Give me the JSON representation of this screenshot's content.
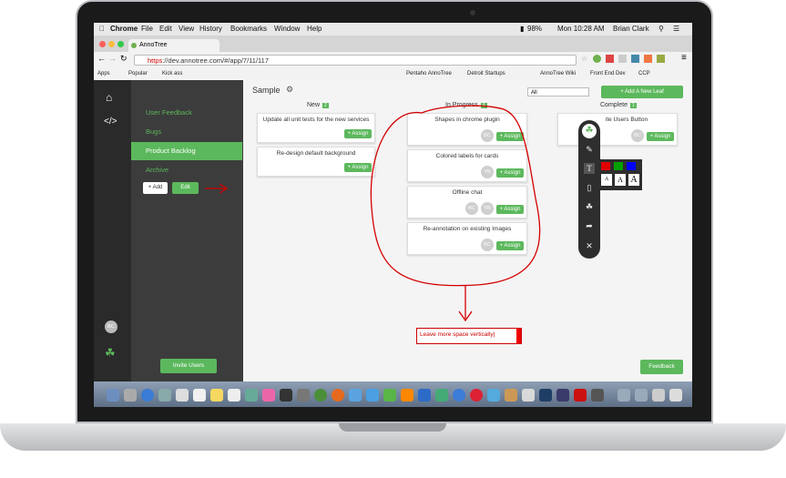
{
  "menubar": {
    "app_name": "Chrome",
    "items": [
      "File",
      "Edit",
      "View",
      "History",
      "Bookmarks",
      "Window",
      "Help"
    ],
    "battery": "98%",
    "clock": "Mon 10:28 AM",
    "user": "Brian Clark"
  },
  "browser": {
    "tab_title": "AnnoTree",
    "url_scheme": "https",
    "url_rest": "://dev.annotree.com/#/app/7/11/117",
    "bookmarks": [
      "Apps",
      "Popular",
      "Kick ass",
      "Pentaho AnnoTree",
      "Detroit Startups",
      "AnnoTree Wiki",
      "Front End Dev",
      "CCP"
    ]
  },
  "sidebar": {
    "items": [
      {
        "label": "User Feedback"
      },
      {
        "label": "Bugs"
      },
      {
        "label": "Product Backlog"
      },
      {
        "label": "Archive"
      }
    ],
    "add_label": "+ Add",
    "edit_label": "Edit",
    "invite_label": "Invite Users",
    "avatar": "BC"
  },
  "board": {
    "title": "Sample",
    "filter_value": "All",
    "add_leaf_label": "+ Add A New Leaf",
    "feedback_label": "Feedback",
    "columns": [
      {
        "title": "New",
        "count": "2",
        "cards": [
          {
            "title": "Update all unit tests for the new services",
            "assign": "+ Assign"
          },
          {
            "title": "Re-design default background",
            "assign": "+ Assign"
          }
        ]
      },
      {
        "title": "In Progress",
        "count": "4",
        "cards": [
          {
            "title": "Shapes in chrome plugin",
            "assign": "+ Assign",
            "avatars": [
              "BC"
            ]
          },
          {
            "title": "Colored labels for cards",
            "assign": "+ Assign",
            "avatars": [
              "YB"
            ]
          },
          {
            "title": "Offline chat",
            "assign": "+ Assign",
            "avatars": [
              "BC",
              "YB"
            ]
          },
          {
            "title": "Re-annotation on existing Images",
            "assign": "+ Assign",
            "avatars": [
              "BC"
            ]
          }
        ]
      },
      {
        "title": "Complete",
        "count": "1",
        "cards": [
          {
            "title": "ite Users Button",
            "assign": "+ Assign",
            "avatars": [
              "BC"
            ]
          }
        ]
      }
    ]
  },
  "annotation": {
    "note_text": "Leave more space vertically|",
    "font_options": [
      "A",
      "A",
      "A"
    ],
    "colors": {
      "red": "#e00000",
      "green": "#00a000",
      "blue": "#0000ff"
    }
  }
}
